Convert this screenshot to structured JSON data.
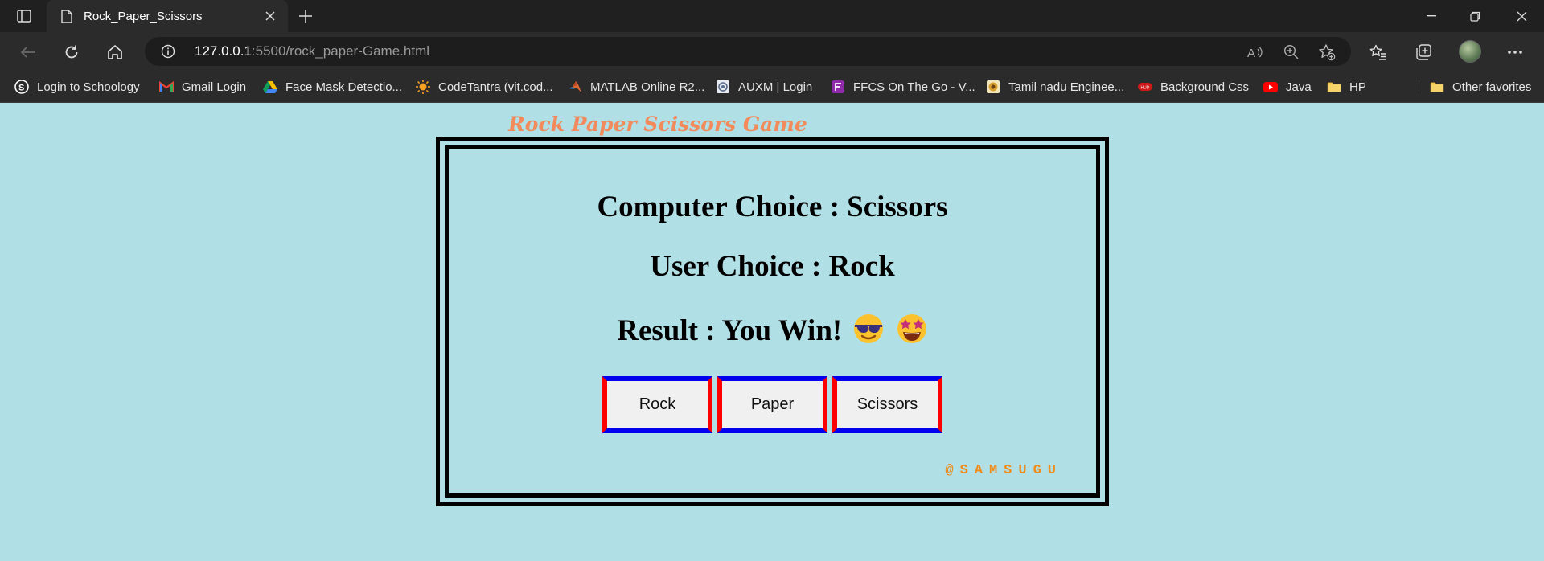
{
  "browser": {
    "tab": {
      "title": "Rock_Paper_Scissors"
    },
    "address_bar": {
      "host": "127.0.0.1",
      "path": ":5500/rock_paper-Game.html"
    },
    "bookmarks": [
      {
        "label": "Login to Schoology",
        "icon": "schoology-icon"
      },
      {
        "label": "Gmail Login",
        "icon": "gmail-icon"
      },
      {
        "label": "Face Mask Detectio...",
        "icon": "google-drive-icon"
      },
      {
        "label": "CodeTantra (vit.cod...",
        "icon": "codetantra-icon"
      },
      {
        "label": "MATLAB Online R2...",
        "icon": "matlab-icon"
      },
      {
        "label": "AUXM | Login",
        "icon": "auxm-icon"
      },
      {
        "label": "FFCS On The Go - V...",
        "icon": "ffcs-icon"
      },
      {
        "label": "Tamil nadu Enginee...",
        "icon": "tnea-icon"
      },
      {
        "label": "Background Css",
        "icon": "hud-icon"
      },
      {
        "label": "Java",
        "icon": "youtube-icon"
      },
      {
        "label": "HP",
        "icon": "folder-icon"
      }
    ],
    "other_favorites": "Other favorites"
  },
  "game": {
    "title": "Rock Paper Scissors Game",
    "computer_choice": "Computer Choice : Scissors",
    "user_choice": "User Choice : Rock",
    "result": "Result : You Win!",
    "result_emojis": [
      "smiling-face-with-sunglasses-emoji",
      "star-struck-emoji"
    ],
    "buttons": {
      "rock": "Rock",
      "paper": "Paper",
      "scissors": "Scissors"
    },
    "signature": "@SAMSUGU"
  },
  "colors": {
    "page_bg": "#b0e0e6",
    "title": "#f28a5b",
    "signature": "#f08c1a",
    "button_border_blue": "#0000ee",
    "button_border_red": "#ff0000"
  }
}
